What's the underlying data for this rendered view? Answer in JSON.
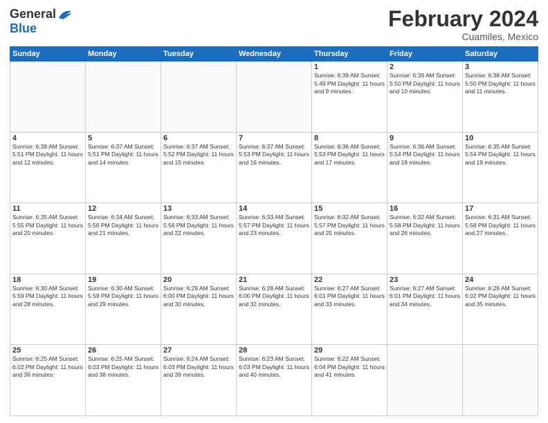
{
  "logo": {
    "general": "General",
    "blue": "Blue"
  },
  "title": "February 2024",
  "location": "Cuamiles, Mexico",
  "days_header": [
    "Sunday",
    "Monday",
    "Tuesday",
    "Wednesday",
    "Thursday",
    "Friday",
    "Saturday"
  ],
  "weeks": [
    [
      {
        "day": "",
        "info": ""
      },
      {
        "day": "",
        "info": ""
      },
      {
        "day": "",
        "info": ""
      },
      {
        "day": "",
        "info": ""
      },
      {
        "day": "1",
        "info": "Sunrise: 6:39 AM\nSunset: 5:49 PM\nDaylight: 11 hours\nand 9 minutes."
      },
      {
        "day": "2",
        "info": "Sunrise: 6:39 AM\nSunset: 5:50 PM\nDaylight: 11 hours\nand 10 minutes."
      },
      {
        "day": "3",
        "info": "Sunrise: 6:38 AM\nSunset: 5:50 PM\nDaylight: 11 hours\nand 11 minutes."
      }
    ],
    [
      {
        "day": "4",
        "info": "Sunrise: 6:38 AM\nSunset: 5:51 PM\nDaylight: 11 hours\nand 12 minutes."
      },
      {
        "day": "5",
        "info": "Sunrise: 6:37 AM\nSunset: 5:51 PM\nDaylight: 11 hours\nand 14 minutes."
      },
      {
        "day": "6",
        "info": "Sunrise: 6:37 AM\nSunset: 5:52 PM\nDaylight: 11 hours\nand 15 minutes."
      },
      {
        "day": "7",
        "info": "Sunrise: 6:37 AM\nSunset: 5:53 PM\nDaylight: 11 hours\nand 16 minutes."
      },
      {
        "day": "8",
        "info": "Sunrise: 6:36 AM\nSunset: 5:53 PM\nDaylight: 11 hours\nand 17 minutes."
      },
      {
        "day": "9",
        "info": "Sunrise: 6:36 AM\nSunset: 5:54 PM\nDaylight: 11 hours\nand 18 minutes."
      },
      {
        "day": "10",
        "info": "Sunrise: 6:35 AM\nSunset: 5:54 PM\nDaylight: 11 hours\nand 19 minutes."
      }
    ],
    [
      {
        "day": "11",
        "info": "Sunrise: 6:35 AM\nSunset: 5:55 PM\nDaylight: 11 hours\nand 20 minutes."
      },
      {
        "day": "12",
        "info": "Sunrise: 6:34 AM\nSunset: 5:56 PM\nDaylight: 11 hours\nand 21 minutes."
      },
      {
        "day": "13",
        "info": "Sunrise: 6:33 AM\nSunset: 5:56 PM\nDaylight: 11 hours\nand 22 minutes."
      },
      {
        "day": "14",
        "info": "Sunrise: 6:33 AM\nSunset: 5:57 PM\nDaylight: 11 hours\nand 23 minutes."
      },
      {
        "day": "15",
        "info": "Sunrise: 6:32 AM\nSunset: 5:57 PM\nDaylight: 11 hours\nand 25 minutes."
      },
      {
        "day": "16",
        "info": "Sunrise: 6:32 AM\nSunset: 5:58 PM\nDaylight: 11 hours\nand 26 minutes."
      },
      {
        "day": "17",
        "info": "Sunrise: 6:31 AM\nSunset: 5:58 PM\nDaylight: 11 hours\nand 27 minutes."
      }
    ],
    [
      {
        "day": "18",
        "info": "Sunrise: 6:30 AM\nSunset: 5:59 PM\nDaylight: 11 hours\nand 28 minutes."
      },
      {
        "day": "19",
        "info": "Sunrise: 6:30 AM\nSunset: 5:59 PM\nDaylight: 11 hours\nand 29 minutes."
      },
      {
        "day": "20",
        "info": "Sunrise: 6:29 AM\nSunset: 6:00 PM\nDaylight: 11 hours\nand 30 minutes."
      },
      {
        "day": "21",
        "info": "Sunrise: 6:28 AM\nSunset: 6:00 PM\nDaylight: 11 hours\nand 32 minutes."
      },
      {
        "day": "22",
        "info": "Sunrise: 6:27 AM\nSunset: 6:01 PM\nDaylight: 11 hours\nand 33 minutes."
      },
      {
        "day": "23",
        "info": "Sunrise: 6:27 AM\nSunset: 6:01 PM\nDaylight: 11 hours\nand 34 minutes."
      },
      {
        "day": "24",
        "info": "Sunrise: 6:26 AM\nSunset: 6:02 PM\nDaylight: 11 hours\nand 35 minutes."
      }
    ],
    [
      {
        "day": "25",
        "info": "Sunrise: 6:25 AM\nSunset: 6:02 PM\nDaylight: 11 hours\nand 36 minutes."
      },
      {
        "day": "26",
        "info": "Sunrise: 6:25 AM\nSunset: 6:03 PM\nDaylight: 11 hours\nand 38 minutes."
      },
      {
        "day": "27",
        "info": "Sunrise: 6:24 AM\nSunset: 6:03 PM\nDaylight: 11 hours\nand 39 minutes."
      },
      {
        "day": "28",
        "info": "Sunrise: 6:23 AM\nSunset: 6:03 PM\nDaylight: 11 hours\nand 40 minutes."
      },
      {
        "day": "29",
        "info": "Sunrise: 6:22 AM\nSunset: 6:04 PM\nDaylight: 11 hours\nand 41 minutes."
      },
      {
        "day": "",
        "info": ""
      },
      {
        "day": "",
        "info": ""
      }
    ]
  ]
}
